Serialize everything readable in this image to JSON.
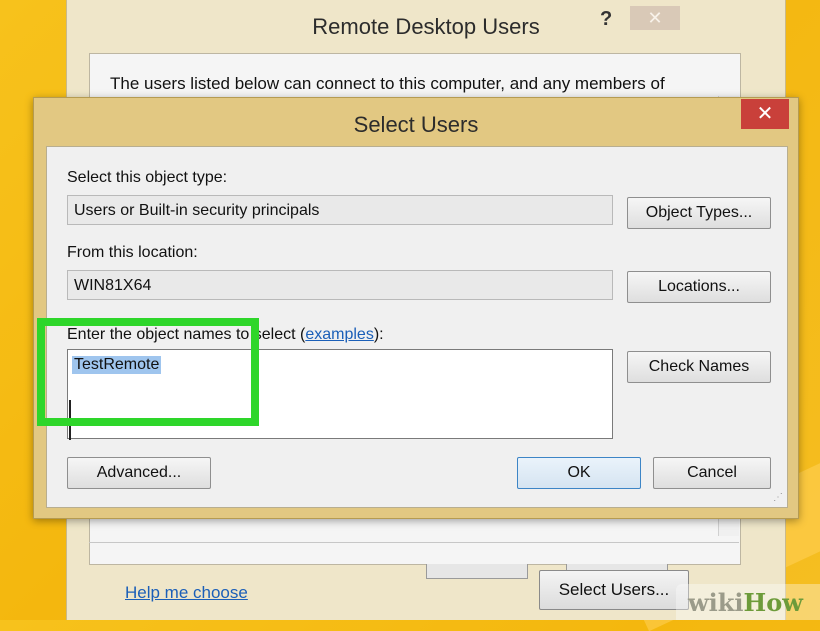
{
  "remote_desktop_users": {
    "title": "Remote Desktop Users",
    "help_label": "?",
    "close_label": "✕",
    "description": "The users listed below can connect to this computer, and any members of",
    "help_link": "Help me choose",
    "select_users_button": "Select Users..."
  },
  "select_users": {
    "title": "Select Users",
    "close_label": "✕",
    "object_type_label": "Select this object type:",
    "object_type_value": "Users or Built-in security principals",
    "object_types_button": "Object Types...",
    "location_label": "From this location:",
    "location_value": "WIN81X64",
    "locations_button": "Locations...",
    "names_label_prefix": "Enter the object names to select (",
    "names_label_link": "examples",
    "names_label_suffix": "):",
    "names_value": "TestRemote",
    "check_names_button": "Check Names",
    "advanced_button": "Advanced...",
    "ok_button": "OK",
    "cancel_button": "Cancel"
  },
  "watermark": {
    "part1": "wiki",
    "part2": "How"
  },
  "colors": {
    "background": "#f4b70e",
    "highlight": "#2ed62a",
    "close_red": "#c9403a",
    "link": "#1b5fb8",
    "selection": "#9fc5ee"
  }
}
